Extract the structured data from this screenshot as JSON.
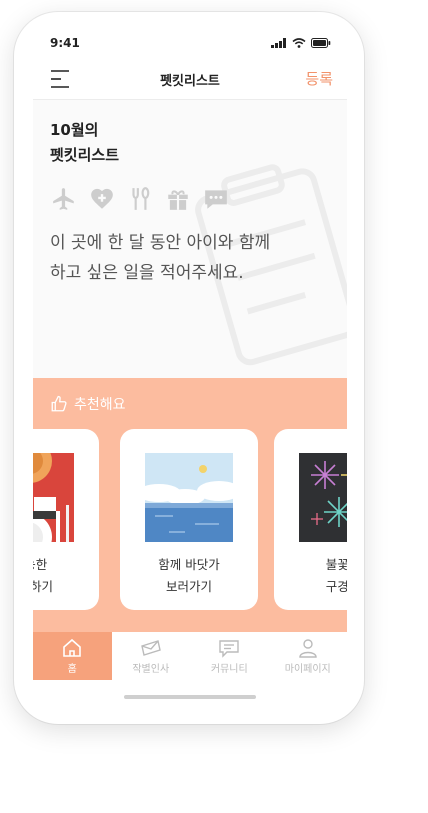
{
  "status_bar": {
    "time": "9:41"
  },
  "header": {
    "title": "펫킷리스트",
    "register_label": "등록"
  },
  "hero": {
    "headline_line1": "10월의",
    "headline_line2": "펫킷리스트",
    "category_icons": [
      "airplane-icon",
      "heart-plus-icon",
      "fork-spoon-icon",
      "gift-icon",
      "chat-icon"
    ],
    "description_line1": "이 곳에 한 달 동안 아이와 함께",
    "description_line2": "하고 싶은 일을 적어주세요."
  },
  "recommend": {
    "title": "추천해요",
    "cards": [
      {
        "line1": "가능한",
        "line2": "외식하기",
        "image": "dining-table"
      },
      {
        "line1": "함께 바닷가",
        "line2": "보러가기",
        "image": "seaside"
      },
      {
        "line1": "불꽃놀",
        "line2": "구경하",
        "image": "fireworks"
      }
    ]
  },
  "tabs": [
    {
      "label": "홈",
      "icon": "home-icon",
      "active": true
    },
    {
      "label": "작별인사",
      "icon": "letter-icon",
      "active": false
    },
    {
      "label": "커뮤니티",
      "icon": "chat-bubble-icon",
      "active": false
    },
    {
      "label": "마이페이지",
      "icon": "person-icon",
      "active": false
    }
  ],
  "colors": {
    "accent": "#f2926a",
    "recommend_bg": "#fcbc9f",
    "active_tab": "#f6a27c"
  }
}
